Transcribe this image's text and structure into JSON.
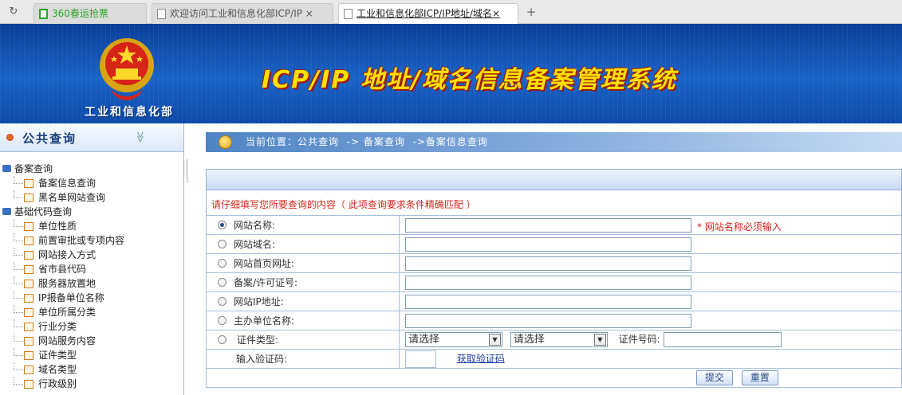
{
  "browser": {
    "tabs": [
      {
        "label": "360春运抢票",
        "active": false
      },
      {
        "label": "欢迎访问工业和信息化部ICP/IP ×",
        "active": false
      },
      {
        "label": "工业和信息化部ICP/IP地址/域名×",
        "active": true
      }
    ],
    "new_tab": "+"
  },
  "header": {
    "org_name": "工业和信息化部",
    "system_title": "ICP/IP 地址/域名信息备案管理系统"
  },
  "sidebar": {
    "title": "公共查询",
    "collapse_icon": "≫",
    "tree": [
      {
        "label": "备案查询",
        "type": "root"
      },
      {
        "label": "备案信息查询",
        "type": "leaf"
      },
      {
        "label": "黑名单网站查询",
        "type": "leaf"
      },
      {
        "label": "基础代码查询",
        "type": "root"
      },
      {
        "label": "单位性质",
        "type": "leaf"
      },
      {
        "label": "前置审批或专项内容",
        "type": "leaf"
      },
      {
        "label": "网站接入方式",
        "type": "leaf"
      },
      {
        "label": "省市县代码",
        "type": "leaf"
      },
      {
        "label": "服务器放置地",
        "type": "leaf"
      },
      {
        "label": "IP报备单位名称",
        "type": "leaf"
      },
      {
        "label": "单位所属分类",
        "type": "leaf"
      },
      {
        "label": "行业分类",
        "type": "leaf"
      },
      {
        "label": "网站服务内容",
        "type": "leaf"
      },
      {
        "label": "证件类型",
        "type": "leaf"
      },
      {
        "label": "域名类型",
        "type": "leaf"
      },
      {
        "label": "行政级别",
        "type": "leaf"
      }
    ]
  },
  "breadcrumb": "当前位置：公共查询  -> 备案查询  ->备案信息查询",
  "form": {
    "instruction": "请仔细填写您所要查询的内容（ 此项查询要求条件精确匹配 ）",
    "required_note": "* 网站名称必须输入",
    "fields": [
      {
        "label": "网站名称:",
        "selected": true,
        "value": ""
      },
      {
        "label": "网站域名:",
        "selected": false,
        "value": ""
      },
      {
        "label": "网站首页网址:",
        "selected": false,
        "value": ""
      },
      {
        "label": "备案/许可证号:",
        "selected": false,
        "value": ""
      },
      {
        "label": "网站IP地址:",
        "selected": false,
        "value": ""
      },
      {
        "label": "主办单位名称:",
        "selected": false,
        "value": ""
      }
    ],
    "cert_type_label": "证件类型:",
    "cert_select_1": "请选择",
    "cert_select_2": "请选择",
    "cert_number_label": "证件号码:",
    "captcha_label": "输入验证码:",
    "captcha_link": "获取验证码",
    "submit_label": "提交",
    "reset_label": "重置"
  }
}
